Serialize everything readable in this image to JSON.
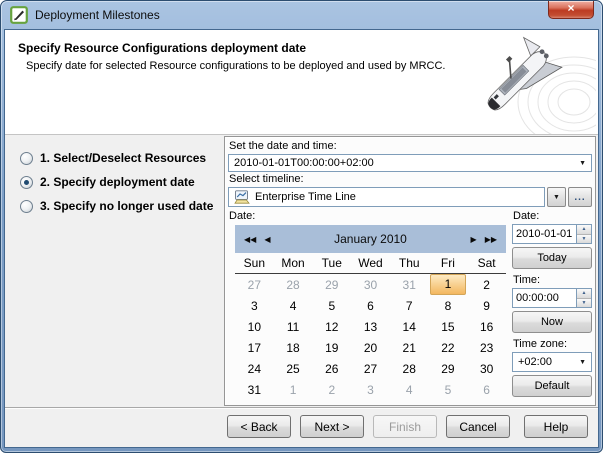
{
  "window": {
    "title": "Deployment Milestones",
    "close_glyph": "×"
  },
  "header": {
    "title": "Specify Resource Configurations deployment date",
    "subtitle": "Specify date for selected Resource configurations to be deployed and used by MRCC."
  },
  "steps": [
    {
      "label": "1. Select/Deselect Resources",
      "selected": false
    },
    {
      "label": "2. Specify deployment date",
      "selected": true
    },
    {
      "label": "3. Specify no longer used date",
      "selected": false
    }
  ],
  "datetime": {
    "label": "Set the date and time:",
    "value": "2010-01-01T00:00:00+02:00"
  },
  "timeline": {
    "label": "Select timeline:",
    "value": "Enterprise Time Line",
    "more_label": "..."
  },
  "icons": {
    "combo_arrow": "▼",
    "spinner_up": "▲",
    "spinner_down": "▼"
  },
  "calendar": {
    "label": "Date:",
    "title": "January 2010",
    "nav": {
      "prev_year": "◀◀",
      "prev_month": "◀",
      "next_month": "▶",
      "next_year": "▶▶"
    },
    "day_names": [
      "Sun",
      "Mon",
      "Tue",
      "Wed",
      "Thu",
      "Fri",
      "Sat"
    ],
    "weeks": [
      [
        {
          "d": "27",
          "muted": true
        },
        {
          "d": "28",
          "muted": true
        },
        {
          "d": "29",
          "muted": true
        },
        {
          "d": "30",
          "muted": true
        },
        {
          "d": "31",
          "muted": true
        },
        {
          "d": "1",
          "selected": true
        },
        {
          "d": "2"
        }
      ],
      [
        {
          "d": "3"
        },
        {
          "d": "4"
        },
        {
          "d": "5"
        },
        {
          "d": "6"
        },
        {
          "d": "7"
        },
        {
          "d": "8"
        },
        {
          "d": "9"
        }
      ],
      [
        {
          "d": "10"
        },
        {
          "d": "11"
        },
        {
          "d": "12"
        },
        {
          "d": "13"
        },
        {
          "d": "14"
        },
        {
          "d": "15"
        },
        {
          "d": "16"
        }
      ],
      [
        {
          "d": "17"
        },
        {
          "d": "18"
        },
        {
          "d": "19"
        },
        {
          "d": "20"
        },
        {
          "d": "21"
        },
        {
          "d": "22"
        },
        {
          "d": "23"
        }
      ],
      [
        {
          "d": "24"
        },
        {
          "d": "25"
        },
        {
          "d": "26"
        },
        {
          "d": "27"
        },
        {
          "d": "28"
        },
        {
          "d": "29"
        },
        {
          "d": "30"
        }
      ],
      [
        {
          "d": "31"
        },
        {
          "d": "1",
          "muted": true
        },
        {
          "d": "2",
          "muted": true
        },
        {
          "d": "3",
          "muted": true
        },
        {
          "d": "4",
          "muted": true
        },
        {
          "d": "5",
          "muted": true
        },
        {
          "d": "6",
          "muted": true
        }
      ]
    ]
  },
  "side": {
    "date_label": "Date:",
    "date_value": "2010-01-01",
    "today_label": "Today",
    "time_label": "Time:",
    "time_value": "00:00:00",
    "now_label": "Now",
    "tz_label": "Time zone:",
    "tz_value": "+02:00",
    "default_label": "Default"
  },
  "footer": {
    "buttons": [
      {
        "name": "back-button",
        "label": "< Back",
        "enabled": true
      },
      {
        "name": "next-button",
        "label": "Next >",
        "enabled": true
      },
      {
        "name": "finish-button",
        "label": "Finish",
        "enabled": false
      },
      {
        "name": "cancel-button",
        "label": "Cancel",
        "enabled": true
      },
      {
        "name": "help-button",
        "label": "Help",
        "enabled": true
      }
    ]
  },
  "colors": {
    "titlebar": "#7d9fc7",
    "calendar_header": "#a9bed8",
    "selected_day": "#f3b75f"
  }
}
